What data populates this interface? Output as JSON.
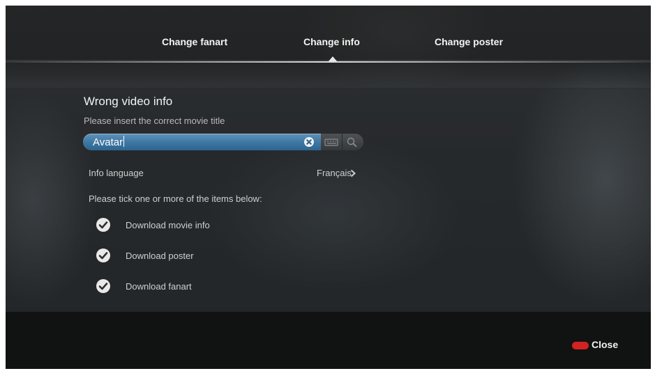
{
  "tabs": [
    {
      "label": "Change fanart"
    },
    {
      "label": "Change info",
      "active": true
    },
    {
      "label": "Change poster"
    }
  ],
  "dialog": {
    "title": "Wrong video info",
    "subtitle": "Please insert the correct movie title",
    "search": {
      "value": "Avatar"
    },
    "info_language": {
      "label": "Info language",
      "value": "Français"
    },
    "items_prompt": "Please tick one or more of the items below:",
    "items": [
      {
        "label": "Download movie info",
        "checked": true
      },
      {
        "label": "Download poster",
        "checked": true
      },
      {
        "label": "Download fanart",
        "checked": true
      }
    ]
  },
  "footer": {
    "close_label": "Close"
  },
  "colors": {
    "accent": "#3f78a3",
    "close_button": "#d22222"
  }
}
